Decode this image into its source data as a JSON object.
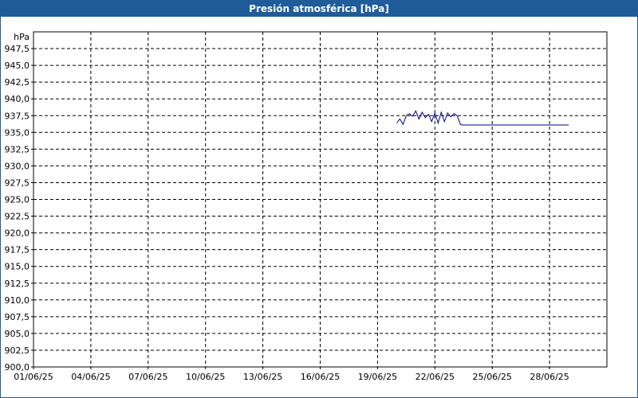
{
  "chart_data": {
    "type": "line",
    "title": "Presión atmosférica [hPa]",
    "ylabel": "hPa",
    "xlabel": "",
    "grid": true,
    "ylim": [
      900.0,
      950.0
    ],
    "xlim": [
      "01/06/25",
      "01/07/25"
    ],
    "y_ticks": [
      "900,0",
      "902,5",
      "905,0",
      "907,5",
      "910,0",
      "912,5",
      "915,0",
      "917,5",
      "920,0",
      "922,5",
      "925,0",
      "927,5",
      "930,0",
      "932,5",
      "935,0",
      "937,5",
      "940,0",
      "942,5",
      "945,0",
      "947,5"
    ],
    "x_ticks": [
      "01/06/25",
      "04/06/25",
      "07/06/25",
      "10/06/25",
      "13/06/25",
      "16/06/25",
      "19/06/25",
      "22/06/25",
      "25/06/25",
      "28/06/25"
    ],
    "series_color": "#00008b",
    "series": [
      {
        "x": [
          "2025-06-20T00:00",
          "2025-06-20T04:00",
          "2025-06-20T08:00",
          "2025-06-20T12:00",
          "2025-06-20T16:00",
          "2025-06-20T20:00",
          "2025-06-21T00:00",
          "2025-06-21T04:00",
          "2025-06-21T08:00",
          "2025-06-21T12:00",
          "2025-06-21T16:00",
          "2025-06-21T20:00",
          "2025-06-22T00:00",
          "2025-06-22T04:00",
          "2025-06-22T08:00",
          "2025-06-22T12:00",
          "2025-06-22T16:00",
          "2025-06-22T20:00",
          "2025-06-23T00:00",
          "2025-06-23T04:00",
          "2025-06-23T08:00",
          "2025-06-23T10:00",
          "2025-06-29T00:00"
        ],
        "y": [
          936.4,
          937.0,
          936.2,
          937.5,
          937.8,
          937.4,
          938.2,
          937.0,
          938.0,
          937.2,
          937.7,
          936.6,
          937.9,
          936.4,
          938.0,
          936.6,
          937.9,
          937.3,
          937.8,
          937.5,
          936.2,
          936.1,
          936.1
        ]
      }
    ]
  }
}
